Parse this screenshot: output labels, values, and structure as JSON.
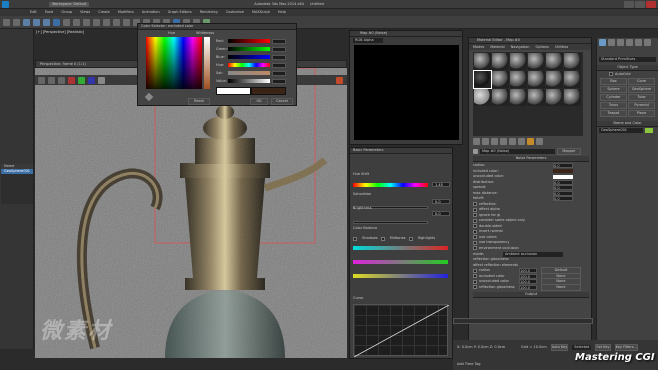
{
  "titlebar": {
    "app_title": "Autodesk 3ds Max 2014 x64",
    "workspace": "Workspace: Default",
    "filename": "Untitled"
  },
  "menu": [
    "Edit",
    "Tools",
    "Group",
    "Views",
    "Create",
    "Modifiers",
    "Animation",
    "Graph Editors",
    "Rendering",
    "Customize",
    "MAXScript",
    "Help"
  ],
  "viewport_left": {
    "label": "[+] [Perspective] [Realistic]"
  },
  "viewport_right": {
    "label": "[+] [Perspective] [Realistic]"
  },
  "color_selector": {
    "title": "Color Selector: excluded color",
    "hue": "Hue",
    "whiteness": "Whiteness",
    "channels": [
      "Red:",
      "Green:",
      "Blue:",
      "Hue:",
      "Sat:",
      "Value:"
    ],
    "reset": "Reset",
    "ok": "OK",
    "cancel": "Cancel"
  },
  "render_window": {
    "title": "Map #0 (Noise)",
    "channel": "RGB Alpha",
    "shown_label": "Displayed Image:"
  },
  "frame_buffer": {
    "title": "Perspective, frame 0 (1:1)",
    "area": "Area to Render:",
    "viewport_sel": "Perspective",
    "value": "1.45"
  },
  "color_correction": {
    "title": "Map #0 (Color Correction)",
    "section": "Basic Parameters",
    "hue_shift": "Hue Shift",
    "saturation": "Saturation",
    "brightness": "Brightness",
    "color_balance": "Color Balance",
    "shadows": "Shadows",
    "midtones": "Midtones",
    "highlights": "Highlights",
    "cyan": "Cyan",
    "red": "Red",
    "magenta": "Magenta",
    "green": "Green",
    "yellow": "Yellow",
    "blue": "Blue",
    "curves": "Curve",
    "val1": "1.45",
    "val2": "0.0",
    "val3": "0.0"
  },
  "material_editor": {
    "title": "Material Editor - Map #0",
    "menu": [
      "Modes",
      "Material",
      "Navigation",
      "Options",
      "Utilities"
    ],
    "map_name": "Map #0 (Noise)",
    "type_btn": "Mapper",
    "section": "Noise Parameters",
    "params": [
      {
        "label": "radius:",
        "value": "0.0"
      },
      {
        "label": "included color:",
        "value": ""
      },
      {
        "label": "unoccluded color:",
        "value": ""
      },
      {
        "label": "distribution:",
        "value": "0.0"
      },
      {
        "label": "spread:",
        "value": "0.0"
      },
      {
        "label": "max distance:",
        "value": "0.0"
      },
      {
        "label": "falloff:",
        "value": "0.0"
      },
      {
        "label": "reflective:",
        "value": ""
      },
      {
        "label": "affect alpha",
        "value": ""
      },
      {
        "label": "ignore for gi",
        "value": ""
      },
      {
        "label": "consider same object only",
        "value": ""
      },
      {
        "label": "double-sided",
        "value": ""
      },
      {
        "label": "invert normal",
        "value": ""
      },
      {
        "label": "use colors",
        "value": ""
      },
      {
        "label": "use transparency",
        "value": ""
      },
      {
        "label": "environment occlusion",
        "value": ""
      }
    ],
    "mode_label": "mode:",
    "mode_value": "Ambient occlusion",
    "rows2": [
      "reflection glossiness",
      "affect reflection elements"
    ],
    "extra": [
      {
        "label": "radius",
        "value": "100.0",
        "right": "Default"
      },
      {
        "label": "occluded color",
        "value": "100.0",
        "right": "None"
      },
      {
        "label": "unoccluded color",
        "value": "100.0",
        "right": "None"
      },
      {
        "label": "reflection glossiness",
        "value": "100.0",
        "right": "None"
      }
    ],
    "footer": "Output"
  },
  "command_panel": {
    "dropdown": "Standard Primitives",
    "section": "Object Type",
    "autogrid": "AutoGrid",
    "buttons": [
      "Box",
      "Cone",
      "Sphere",
      "GeoSphere",
      "Cylinder",
      "Tube",
      "Torus",
      "Pyramid",
      "Teapot",
      "Plane"
    ],
    "name_color": "Name and Color",
    "name_value": "GeoSphere001"
  },
  "scene_explorer": {
    "items": [
      "Name",
      "GeoSphere001"
    ]
  },
  "status": {
    "coords": "X: 0.0cm  Y: 0.0cm  Z: 0.0cm",
    "grid": "Grid = 10.0cm",
    "autokey": "Auto Key",
    "selected": "Selected",
    "set_key": "Set Key",
    "key_filters": "Key Filters...",
    "add_time_tag": "Add Time Tag"
  },
  "watermark": {
    "left": "微素材",
    "right": "Mastering CGI"
  },
  "colors": {
    "accent": "#3b6ea5",
    "panel": "#444444",
    "dark": "#1a1a1a"
  }
}
